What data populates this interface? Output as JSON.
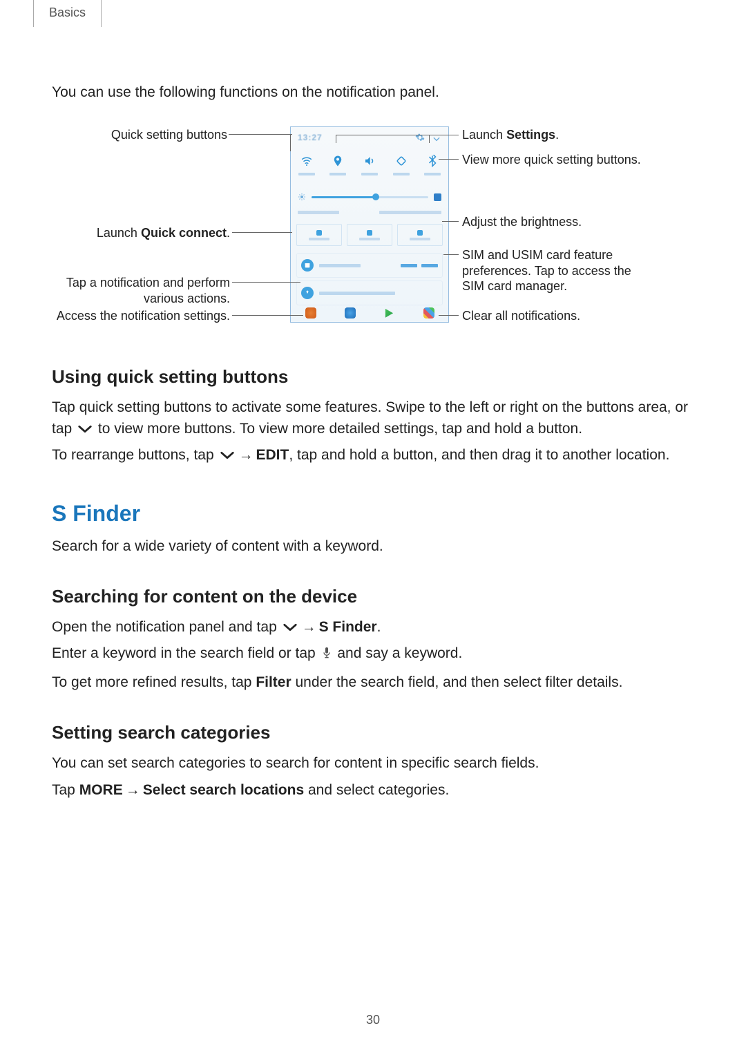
{
  "doc": {
    "section": "Basics",
    "pageNumber": "30"
  },
  "intro": "You can use the following functions on the notification panel.",
  "colors": {
    "accent": "#1a76bb"
  },
  "diagram": {
    "left": {
      "quickSettingButtons": "Quick setting buttons",
      "launchQuickConnectPrefix": "Launch ",
      "launchQuickConnectBold": "Quick connect",
      "launchQuickConnectSuffix": ".",
      "tapNotification1": "Tap a notification and perform",
      "tapNotification2": "various actions.",
      "accessSettings": "Access the notification settings."
    },
    "right": {
      "launchSettingsPrefix": "Launch ",
      "launchSettingsBold": "Settings",
      "launchSettingsSuffix": ".",
      "viewMore": "View more quick setting buttons.",
      "adjustBrightness": "Adjust the brightness.",
      "sim1": "SIM and USIM card feature",
      "sim2": "preferences. Tap to access the",
      "sim3": "SIM card manager.",
      "clearAll": "Clear all notifications."
    }
  },
  "section1": {
    "title": "Using quick setting buttons",
    "p1a": "Tap quick setting buttons to activate some features. Swipe to the left or right on the buttons area, or tap ",
    "p1b": " to view more buttons. To view more detailed settings, tap and hold a button.",
    "p2a": "To rearrange buttons, tap ",
    "p2arrow": "→",
    "p2bold": "EDIT",
    "p2b": ", tap and hold a button, and then drag it to another location."
  },
  "sfinder": {
    "title": "S Finder",
    "desc": "Search for a wide variety of content with a keyword.",
    "sub1": {
      "title": "Searching for content on the device",
      "p1a": "Open the notification panel and tap ",
      "p1arrow": "→",
      "p1bold": "S Finder",
      "p1suffix": ".",
      "p2a": "Enter a keyword in the search field or tap ",
      "p2b": " and say a keyword.",
      "p3a": "To get more refined results, tap ",
      "p3bold": "Filter",
      "p3b": " under the search field, and then select filter details."
    },
    "sub2": {
      "title": "Setting search categories",
      "p1": "You can set search categories to search for content in specific search fields.",
      "p2a": "Tap ",
      "p2bold1": "MORE",
      "p2arrow": "→",
      "p2bold2": "Select search locations",
      "p2b": " and select categories."
    }
  }
}
